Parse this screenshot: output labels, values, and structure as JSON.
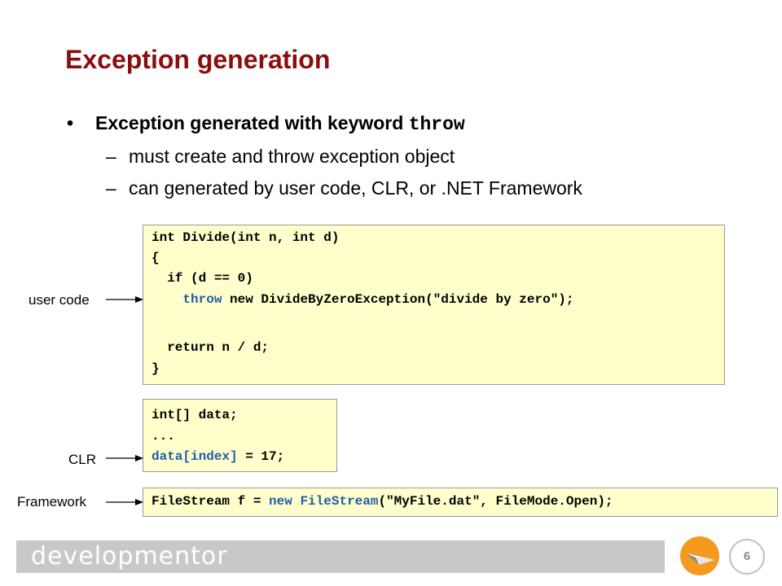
{
  "slide": {
    "title": "Exception generation",
    "bullet_dot": "•",
    "bullet_text": "Exception generated with keyword ",
    "bullet_keyword": "throw",
    "sub_dash": "–",
    "sub_1": "must create and throw exception object",
    "sub_2": "can generated by user code, CLR, or .NET Framework"
  },
  "code_user": {
    "l1": "int Divide(int n, int d)",
    "l2": "{",
    "l3": "  if (d == 0)",
    "l4_indent": "    ",
    "l4_kw": "throw",
    "l4_rest": " new DivideByZeroException(\"divide by zero\");",
    "l5": "  return n / d;",
    "l6": "}"
  },
  "code_clr": {
    "l1": "int[] data;",
    "l2": "...",
    "l3_kw": "data[index]",
    "l3_rest": " = 17;"
  },
  "code_fw": {
    "p1": "FileStream f = ",
    "kw1": "new",
    "p2": " ",
    "kw2": "FileStream",
    "p3": "(\"MyFile.dat\", FileMode.Open);"
  },
  "labels": {
    "user_code": "user code",
    "clr": "CLR",
    "framework": "Framework"
  },
  "footer": {
    "brand": "developmentor",
    "page_number": "6"
  },
  "colors": {
    "title": "#8b0d0d",
    "code_bg": "#ffffcc",
    "keyword": "#1f5ea8",
    "logo": "#f39a1f"
  },
  "icons": {
    "logo": "paper-plane-icon"
  }
}
